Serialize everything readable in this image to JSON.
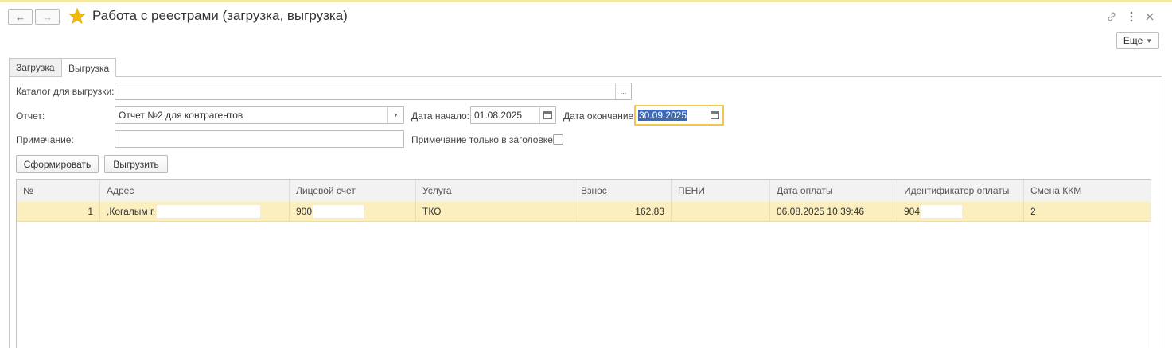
{
  "header": {
    "title": "Работа с реестрами (загрузка, выгрузка)",
    "back_glyph": "←",
    "forward_glyph": "→",
    "more_label": "Еще"
  },
  "tabs": [
    {
      "label": "Загрузка",
      "active": false
    },
    {
      "label": "Выгрузка",
      "active": true
    }
  ],
  "form": {
    "catalog_label": "Каталог для выгрузки:",
    "catalog_value": "",
    "catalog_button": "...",
    "report_label": "Отчет:",
    "report_value": "Отчет №2 для контрагентов",
    "date_start_label": "Дата начало:",
    "date_start_value": "01.08.2025",
    "date_end_label": "Дата окончание:",
    "date_end_value": "30.09.2025",
    "note_label": "Примечание:",
    "note_value": "",
    "note_header_only_label": "Примечание только в заголовке:",
    "note_header_only_checked": false
  },
  "buttons": {
    "generate": "Сформировать",
    "export": "Выгрузить"
  },
  "table": {
    "columns": [
      "№",
      "Адрес",
      "Лицевой счет",
      "Услуга",
      "Взнос",
      "ПЕНИ",
      "Дата оплаты",
      "Идентификатор оплаты",
      "Смена ККМ"
    ],
    "rows": [
      {
        "num": "1",
        "address": ",Когалым г,",
        "account": "900",
        "service": "ТКО",
        "payment": "162,83",
        "penalty": "",
        "pay_date": "06.08.2025 10:39:46",
        "pay_id": "904",
        "kkm_shift": "2"
      }
    ]
  },
  "colors": {
    "accent_star": "#f0b90b",
    "row_highlight": "#fbefbf",
    "focus_border": "#f2c84b",
    "selection": "#3d6ab3"
  }
}
